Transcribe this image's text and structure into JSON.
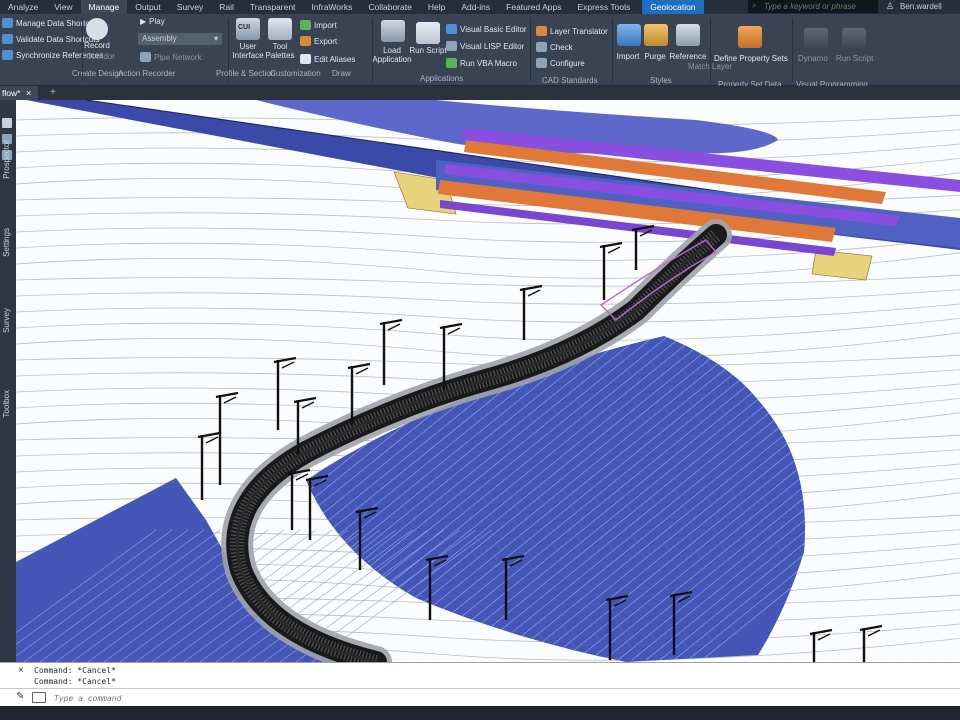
{
  "menu": {
    "tabs": [
      "Analyze",
      "View",
      "Manage",
      "Output",
      "Survey",
      "Rail",
      "Transparent",
      "InfraWorks",
      "Collaborate",
      "Help",
      "Add-ins",
      "Featured Apps",
      "Express Tools",
      "Geolocation"
    ],
    "active": "Manage",
    "search_placeholder": "Type a keyword or phrase",
    "user": "Ben.wardell"
  },
  "ribbon": {
    "data_shortcuts": {
      "manage": "Manage Data Shortcuts",
      "validate": "Validate Data Shortcuts",
      "synchronize": "Synchronize References"
    },
    "action_recorder": {
      "record": "Record",
      "play": "Play",
      "assembly": "Assembly",
      "pipe_network": "Pipe Network",
      "corridor": "Corridor",
      "title": "Action Recorder",
      "create_design": "Create Design"
    },
    "customization": {
      "user_interface": "User Interface",
      "tool_palettes": "Tool Palettes",
      "import": "Import",
      "export": "Export",
      "edit_aliases": "Edit Aliases",
      "title": "Customization",
      "cui_badge": "CUI",
      "profile": "Profile & Section",
      "draw": "Draw"
    },
    "applications": {
      "load_application": "Load Application",
      "run_script": "Run Script",
      "visual_basic_editor": "Visual Basic Editor",
      "visual_lisp_editor": "Visual LISP Editor",
      "run_vba_macro": "Run VBA Macro",
      "title": "Applications"
    },
    "cad_standards": {
      "layer_translator": "Layer Translator",
      "check": "Check",
      "configure": "Configure",
      "title": "CAD Standards"
    },
    "styles": {
      "import": "Import",
      "purge": "Purge",
      "reference": "Reference",
      "title": "Styles",
      "match_layer": "Match Layer"
    },
    "property_set_data": {
      "define": "Define Property Sets",
      "title": "Property Set Data"
    },
    "visual_programming": {
      "dynamo": "Dynamo",
      "run_script": "Run Script",
      "title": "Visual Programming"
    }
  },
  "document": {
    "tab_label": "flow*",
    "close": "×",
    "add": "+"
  },
  "palette": {
    "labels": [
      "Prospector",
      "Settings",
      "Survey",
      "Toolbox"
    ]
  },
  "command": {
    "history": [
      "Command: *Cancel*",
      "Command: *Cancel*"
    ],
    "placeholder": "Type a command",
    "close": "×"
  },
  "colors": {
    "bridge_deck_purple": "#8a4fe0",
    "bridge_beam_orange": "#e0783a",
    "abutment_yellow": "#e8d27a",
    "surface_blue": "#4555b8",
    "rail_black": "#1a1a1a"
  },
  "icons": {
    "close": "close-icon",
    "wrench": "wrench-icon",
    "search": "search-icon",
    "user": "user-icon"
  }
}
